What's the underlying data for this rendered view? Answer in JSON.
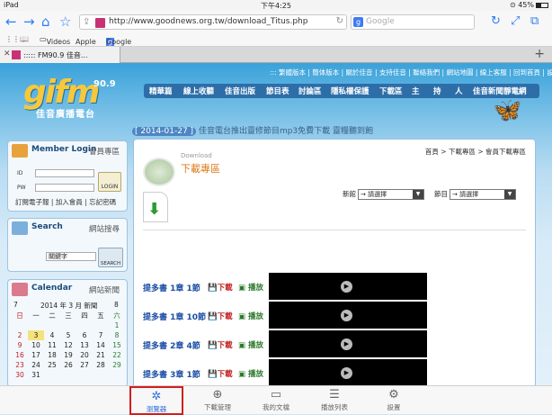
{
  "status": {
    "device": "iPad",
    "time": "下午4:25",
    "battery": "45%"
  },
  "nav": {
    "url": "http://www.goodnews.org.tw/download_Titus.php",
    "search_placeholder": "Google"
  },
  "bookmarks": [
    {
      "label": "Videos"
    },
    {
      "label": "Apple"
    },
    {
      "label": "Google"
    }
  ],
  "tabs": [
    {
      "label": "::::: FM90.9 佳音..."
    }
  ],
  "site": {
    "logo_text": "gifm",
    "logo_freq": "90.9",
    "logo_name": "佳音廣播電台",
    "top_links": "::: 繁體版本 | 簡体版本 | 關於佳音 | 支持佳音 | 聯絡我們 | 網站地圖 | 線上客服 | 回到首頁 | 設為首頁",
    "menu": [
      "精華篇",
      "線上收聽",
      "佳音出版",
      "節目表",
      "討論區",
      "隱私權保護",
      "下載區",
      "主",
      "持",
      "人",
      "佳音新聞靜電網"
    ],
    "ticker_date": "[ 2014-01-27 ]",
    "ticker_text": "佳音電台推出靈修節目mp3免費下載 靈糧聽到飽"
  },
  "sidebar": {
    "login": {
      "title": "Member Login",
      "title_zh": "會員專區",
      "id_label": "ID",
      "pw_label": "PW",
      "button": "LOGIN",
      "links": "訂閱電子報 | 加入會員 | 忘記密碼"
    },
    "search": {
      "title": "Search",
      "title_zh": "網站搜尋",
      "keyword": "關鍵字",
      "button": "SEARCH"
    },
    "calendar": {
      "title": "Calendar",
      "title_zh": "網站新聞",
      "prev": "7",
      "year_month": "2014 年 3 月 新聞",
      "next": "8",
      "weekdays": [
        "日",
        "一",
        "二",
        "三",
        "四",
        "五",
        "六"
      ],
      "rows": [
        [
          "",
          "",
          "",
          "",
          "",
          "",
          "1"
        ],
        [
          "2",
          "3",
          "4",
          "5",
          "6",
          "7",
          "8"
        ],
        [
          "9",
          "10",
          "11",
          "12",
          "13",
          "14",
          "15"
        ],
        [
          "16",
          "17",
          "18",
          "19",
          "20",
          "21",
          "22"
        ],
        [
          "23",
          "24",
          "25",
          "26",
          "27",
          "28",
          "29"
        ],
        [
          "30",
          "31",
          "",
          "",
          "",
          "",
          ""
        ]
      ],
      "highlight": "3"
    }
  },
  "main": {
    "breadcrumb": "首頁 > 下載專區 > 會員下載專區",
    "title_en": "Download",
    "title_zh": "下載專區",
    "filter_new_label": "新館",
    "filter_program_label": "節目",
    "select_placeholder": "→ 請選擇",
    "download_label": "下載",
    "play_label": "播放",
    "items": [
      {
        "chapter": "提多書 1章 1節"
      },
      {
        "chapter": "提多書 1章 10節"
      },
      {
        "chapter": "提多書 2章 4節"
      },
      {
        "chapter": "提多書 3章 1節"
      }
    ]
  },
  "toolbar": [
    {
      "label": "瀏覽器",
      "icon": "compass-icon",
      "active": true
    },
    {
      "label": "下載管理",
      "icon": "download-icon",
      "active": false
    },
    {
      "label": "我的文檔",
      "icon": "folder-icon",
      "active": false
    },
    {
      "label": "播放列表",
      "icon": "list-icon",
      "active": false
    },
    {
      "label": "設置",
      "icon": "gear-icon",
      "active": false
    }
  ],
  "colors": {
    "accent": "#2d7cf6",
    "active_border": "#d21e1e",
    "site_blue": "#2e6ea8",
    "link_blue": "#1d4fa5",
    "download_red": "#c02020",
    "play_green": "#2b7a2b"
  }
}
